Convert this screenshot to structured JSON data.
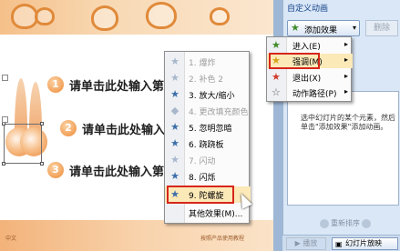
{
  "panel": {
    "title": "自定义动画",
    "add_effect_label": "添加效果",
    "add_effect_arrow": "▾",
    "remove_label": "删除",
    "hint_text": "选中幻灯片的某个元素，然后单击\"添加效果\"添加动画。",
    "reorder_label": "重新排序",
    "play_label": "▶ 播放",
    "slideshow_label": "幻灯片放映"
  },
  "slide": {
    "bullets": [
      {
        "num": "1",
        "text": "请单击此处输入第"
      },
      {
        "num": "2",
        "text": "请单击此处输入"
      },
      {
        "num": "3",
        "text": "请单击此处输入第"
      }
    ],
    "footer_left": "中文",
    "footer_right": "按照产品使用教程"
  },
  "effect_menu": {
    "items": [
      {
        "label": "1. 爆炸",
        "icon": "★",
        "disabled": true
      },
      {
        "label": "2. 补色 2",
        "icon": "★",
        "disabled": true
      },
      {
        "label": "3. 放大/缩小",
        "icon": "★",
        "disabled": false
      },
      {
        "label": "4. 更改填充颜色",
        "icon": "◆",
        "disabled": true
      },
      {
        "label": "5. 忽明忽暗",
        "icon": "★",
        "disabled": false
      },
      {
        "label": "6. 跷跷板",
        "icon": "★",
        "disabled": false
      },
      {
        "label": "7. 闪动",
        "icon": "★",
        "disabled": true
      },
      {
        "label": "8. 闪烁",
        "icon": "★",
        "disabled": false
      },
      {
        "label": "9. 陀螺旋",
        "icon": "★",
        "disabled": false
      },
      {
        "label": "其他效果(M)...",
        "icon": "",
        "disabled": false
      }
    ]
  },
  "submenu": {
    "items": [
      {
        "label": "进入(E)",
        "icon": "★",
        "color": "#3e8b2a"
      },
      {
        "label": "强调(M)",
        "icon": "★",
        "color": "#d8a21a"
      },
      {
        "label": "退出(X)",
        "icon": "★",
        "color": "#d13b2b"
      },
      {
        "label": "动作路径(P)",
        "icon": "☆",
        "color": "#555555"
      }
    ],
    "submenu_arrow": "▸"
  },
  "colors": {
    "highlight_box": "#d7261b",
    "menu_hover": "#fce9b8",
    "accent_orange": "#ee8a35"
  }
}
